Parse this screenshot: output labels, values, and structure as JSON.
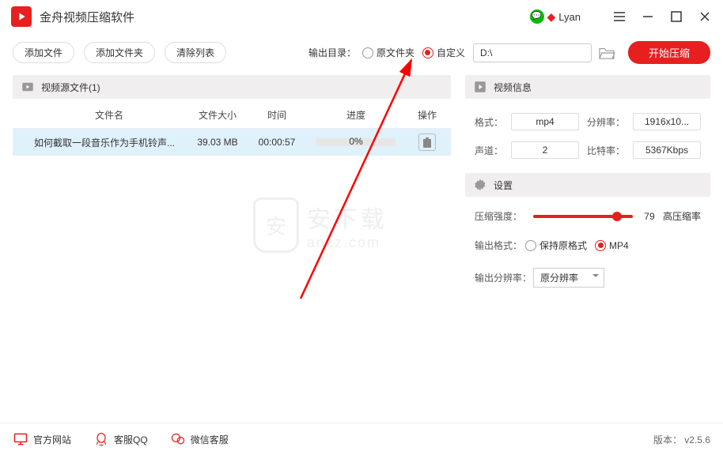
{
  "titlebar": {
    "app_name": "金舟视频压缩软件",
    "username": "Lyan"
  },
  "toolbar": {
    "add_file": "添加文件",
    "add_folder": "添加文件夹",
    "clear_list": "清除列表",
    "outdir_label": "输出目录：",
    "radio_orig": "原文件夹",
    "radio_custom": "自定义",
    "path_value": "D:\\",
    "start": "开始压缩"
  },
  "source": {
    "header": "视频源文件(1)",
    "cols": {
      "name": "文件名",
      "size": "文件大小",
      "time": "时间",
      "progress": "进度",
      "op": "操作"
    },
    "rows": [
      {
        "name": "如何截取一段音乐作为手机铃声...",
        "size": "39.03 MB",
        "time": "00:00:57",
        "progress": "0%"
      }
    ]
  },
  "info": {
    "header": "视频信息",
    "format_lbl": "格式：",
    "format_val": "mp4",
    "res_lbl": "分辨率：",
    "res_val": "1916x10...",
    "ch_lbl": "声道：",
    "ch_val": "2",
    "br_lbl": "比特率：",
    "br_val": "5367Kbps"
  },
  "settings": {
    "header": "设置",
    "strength_lbl": "压缩强度：",
    "strength_val": "79",
    "strength_txt": "高压缩率",
    "outfmt_lbl": "输出格式：",
    "outfmt_keep": "保持原格式",
    "outfmt_mp4": "MP4",
    "outres_lbl": "输出分辨率：",
    "outres_val": "原分辨率"
  },
  "watermark": {
    "l1": "安下载",
    "l2": "anxz.com"
  },
  "footer": {
    "site": "官方网站",
    "qq": "客服QQ",
    "wx": "微信客服",
    "version": "版本： v2.5.6"
  }
}
